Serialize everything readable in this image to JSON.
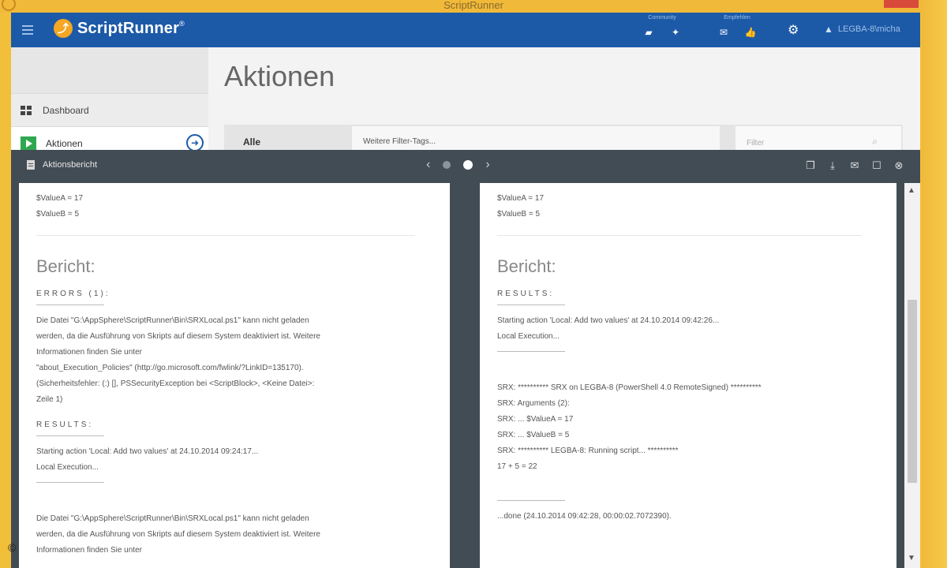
{
  "window": {
    "title": "ScriptRunner"
  },
  "header": {
    "brand": "ScriptRunner",
    "brand_mark": "®",
    "community_label": "Community",
    "community_icons": [
      "chat-icon",
      "twitter-icon"
    ],
    "empfehlen_label": "Empfehlen",
    "empfehlen_icons": [
      "mail-icon",
      "thumbs-up-icon"
    ],
    "user": "LEGBA-8\\micha"
  },
  "sidebar": {
    "items": [
      {
        "label": "Dashboard",
        "icon": "dashboard-icon"
      },
      {
        "label": "Aktionen",
        "icon": "play-icon"
      }
    ]
  },
  "main": {
    "title": "Aktionen",
    "filter": {
      "all": "Alle",
      "tags": "Weitere Filter-Tags...",
      "search_placeholder": "Filter"
    }
  },
  "report": {
    "title": "Aktionsbericht",
    "left": {
      "vars": [
        "$ValueA = 17",
        "$ValueB = 5"
      ],
      "heading": "Bericht:",
      "errors_label": "ERRORS (1):",
      "error_text": [
        "Die Datei \"G:\\AppSphere\\ScriptRunner\\Bin\\SRXLocal.ps1\" kann nicht geladen",
        "werden, da die Ausführung von Skripts auf diesem System deaktiviert ist. Weitere",
        "Informationen finden Sie unter",
        "\"about_Execution_Policies\" (http://go.microsoft.com/fwlink/?LinkID=135170).",
        "(Sicherheitsfehler: (:) [], PSSecurityException bei <ScriptBlock>, <Keine Datei>:",
        "Zeile 1)"
      ],
      "results_label": "RESULTS:",
      "results_text": [
        "Starting action 'Local: Add two values' at 24.10.2014 09:24:17...",
        "Local Execution..."
      ],
      "trailing_text": [
        "Die Datei \"G:\\AppSphere\\ScriptRunner\\Bin\\SRXLocal.ps1\" kann nicht geladen",
        "werden, da die Ausführung von Skripts auf diesem System deaktiviert ist. Weitere",
        "Informationen finden Sie unter"
      ]
    },
    "right": {
      "vars": [
        "$ValueA = 17",
        "$ValueB = 5"
      ],
      "heading": "Bericht:",
      "results_label": "RESULTS:",
      "results_text": [
        "Starting action 'Local: Add two values' at 24.10.2014 09:42:26...",
        "Local Execution..."
      ],
      "srx_lines": [
        "SRX: ********** SRX on LEGBA-8 (PowerShell 4.0 RemoteSigned) **********",
        "SRX: Arguments (2):",
        "SRX: ... $ValueA = 17",
        "SRX: ... $ValueB = 5",
        "SRX: ********** LEGBA-8: Running script... **********",
        "17 + 5 = 22"
      ],
      "done": "...done (24.10.2014 09:42:28, 00:00:02.7072390)."
    }
  },
  "copyright": "©"
}
